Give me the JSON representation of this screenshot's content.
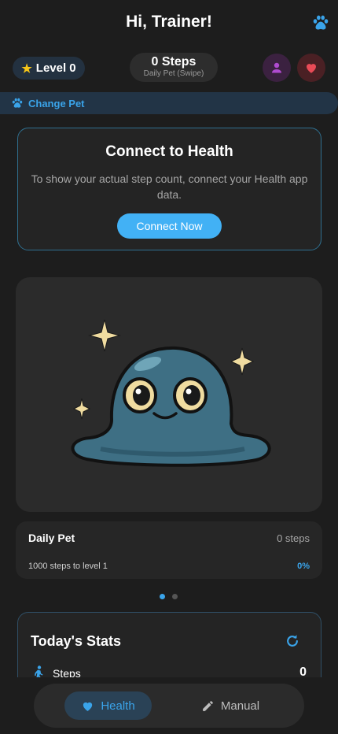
{
  "header": {
    "title": "Hi, Trainer!"
  },
  "level": {
    "label": "Level 0"
  },
  "steps_pill": {
    "count": "0 Steps",
    "subtitle": "Daily Pet (Swipe)"
  },
  "change_pet": {
    "label": "Change Pet"
  },
  "connect": {
    "title": "Connect to Health",
    "description": "To show your actual step count, connect your Health app data.",
    "button": "Connect Now"
  },
  "daily_pet": {
    "name": "Daily Pet",
    "steps": "0 steps",
    "level_text": "1000 steps to level 1",
    "percent": "0%"
  },
  "carousel": {
    "pages": 2,
    "active": 1
  },
  "stats": {
    "title": "Today's Stats",
    "rows": [
      {
        "label": "Steps",
        "value": "0"
      }
    ]
  },
  "nav": {
    "health": "Health",
    "manual": "Manual"
  },
  "colors": {
    "accent": "#3aa4ea",
    "heart": "#e94b57",
    "star": "#f5c518",
    "profile": "#b04bd0"
  },
  "icons": [
    "paw-icon",
    "star-icon",
    "person-icon",
    "heart-icon",
    "refresh-icon",
    "walk-icon",
    "pencil-icon"
  ]
}
